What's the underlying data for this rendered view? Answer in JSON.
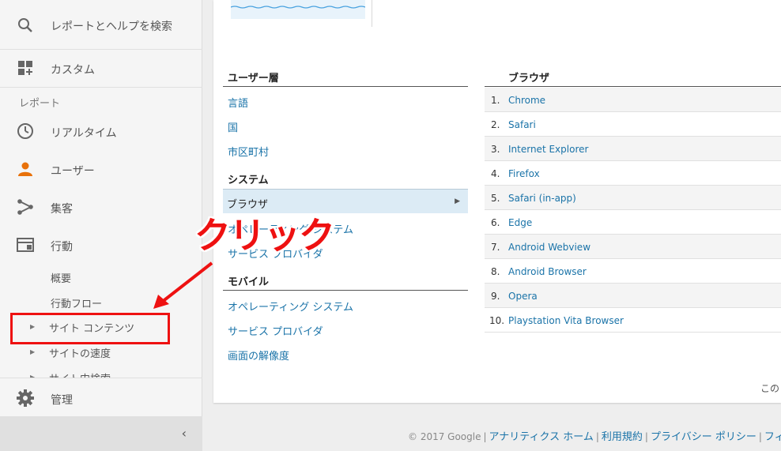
{
  "sidebar": {
    "search_label": "レポートとヘルプを検索",
    "custom_label": "カスタム",
    "reports_section": "レポート",
    "realtime_label": "リアルタイム",
    "users_label": "ユーザー",
    "acquisition_label": "集客",
    "behavior_label": "行動",
    "behavior_sub": [
      "概要",
      "行動フロー",
      "サイト コンテンツ",
      "サイトの速度",
      "サイト内検索"
    ],
    "admin_label": "管理",
    "collapse_icon": "chevron-left-icon"
  },
  "main": {
    "user_segment_heading": "ユーザー層",
    "user_segment_links": [
      "言語",
      "国",
      "市区町村"
    ],
    "system_heading": "システム",
    "system_selected": "ブラウザ",
    "system_links": [
      "オペレーティング システム",
      "サービス プロバイダ"
    ],
    "mobile_heading": "モバイル",
    "mobile_links": [
      "オペレーティング システム",
      "サービス プロバイダ",
      "画面の解像度"
    ],
    "browser_heading": "ブラウザ",
    "browser_rows": [
      {
        "num": "1.",
        "name": "Chrome"
      },
      {
        "num": "2.",
        "name": "Safari"
      },
      {
        "num": "3.",
        "name": "Internet Explorer"
      },
      {
        "num": "4.",
        "name": "Firefox"
      },
      {
        "num": "5.",
        "name": "Safari (in-app)"
      },
      {
        "num": "6.",
        "name": "Edge"
      },
      {
        "num": "7.",
        "name": "Android Webview"
      },
      {
        "num": "8.",
        "name": "Android Browser"
      },
      {
        "num": "9.",
        "name": "Opera"
      },
      {
        "num": "10.",
        "name": "Playstation Vita Browser"
      }
    ],
    "card_footer_text": "この"
  },
  "footer": {
    "copyright": "© 2017 Google",
    "links": [
      "アナリティクス ホーム",
      "利用規約",
      "プライバシー ポリシー",
      "フィ"
    ]
  },
  "annotation": {
    "text": "クリック",
    "color": "#ee1111"
  },
  "colors": {
    "link": "#1a73a8",
    "user_icon": "#e8710a",
    "selected_bg": "#dcebf5"
  }
}
